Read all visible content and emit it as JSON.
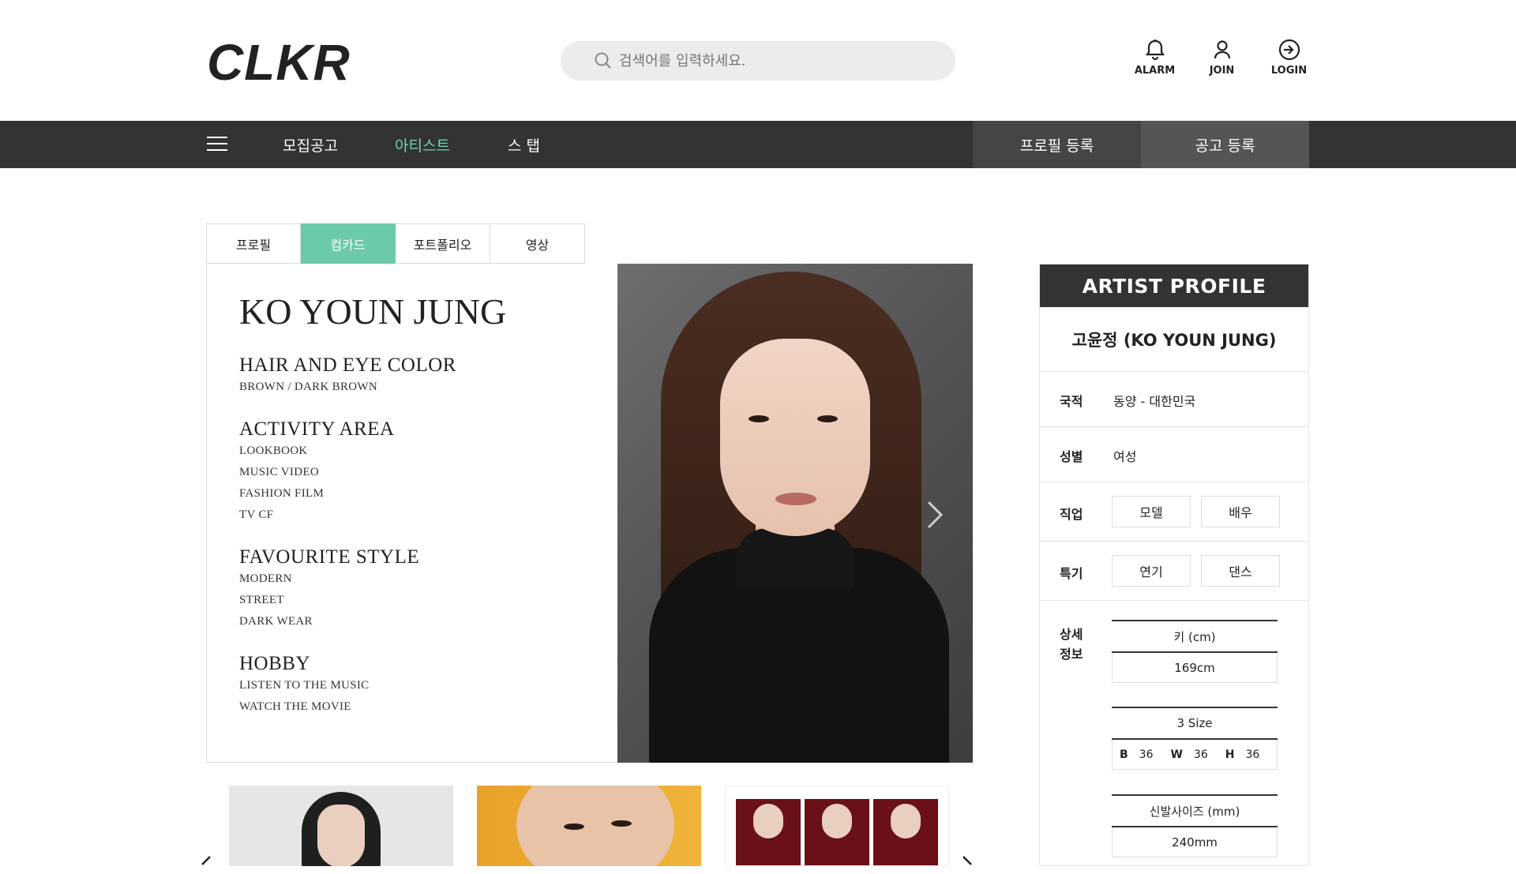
{
  "header": {
    "logo": "CLKR",
    "search_placeholder": "검색어를 입력하세요.",
    "icons": [
      {
        "label": "ALARM",
        "icon": "bell-icon"
      },
      {
        "label": "JOIN",
        "icon": "user-icon"
      },
      {
        "label": "LOGIN",
        "icon": "login-icon"
      }
    ]
  },
  "nav": {
    "items": [
      "모집공고",
      "아티스트",
      "스 탭"
    ],
    "active": "아티스트",
    "buttons": [
      "프로필 등록",
      "공고 등록"
    ],
    "accent": "#6fd5b1"
  },
  "tabs": {
    "items": [
      "프로필",
      "컴카드",
      "포트폴리오",
      "영상"
    ],
    "active": "컴카드",
    "active_color": "#6ccaa8"
  },
  "compcard": {
    "name": "KO YOUN JUNG",
    "sections": [
      {
        "title": "HAIR AND EYE COLOR",
        "items": [
          "BROWN / DARK BROWN"
        ]
      },
      {
        "title": "ACTIVITY AREA",
        "items": [
          "LOOKBOOK",
          "MUSIC VIDEO",
          "FASHION FILM",
          "TV CF"
        ]
      },
      {
        "title": "FAVOURITE STYLE",
        "items": [
          "MODERN",
          "STREET",
          "DARK WEAR"
        ]
      },
      {
        "title": "HOBBY",
        "items": [
          "LISTEN TO THE MUSIC",
          "WATCH THE MOVIE"
        ]
      }
    ]
  },
  "artist_profile": {
    "heading": "ARTIST PROFILE",
    "name": "고윤정 (KO YOUN JUNG)",
    "nationality_label": "국적",
    "nationality": "동양 - 대한민국",
    "gender_label": "성별",
    "gender": "여성",
    "job_label": "직업",
    "jobs": [
      "모델",
      "배우"
    ],
    "skill_label": "특기",
    "skills": [
      "연기",
      "댄스"
    ],
    "detail_label_1": "상세",
    "detail_label_2": "정보",
    "height_label": "키 (cm)",
    "height": "169cm",
    "size_label": "3 Size",
    "sizes": {
      "b_label": "B",
      "b": "36",
      "w_label": "W",
      "w": "36",
      "h_label": "H",
      "h": "36"
    },
    "shoe_label": "신발사이즈 (mm)",
    "shoe": "240mm"
  }
}
